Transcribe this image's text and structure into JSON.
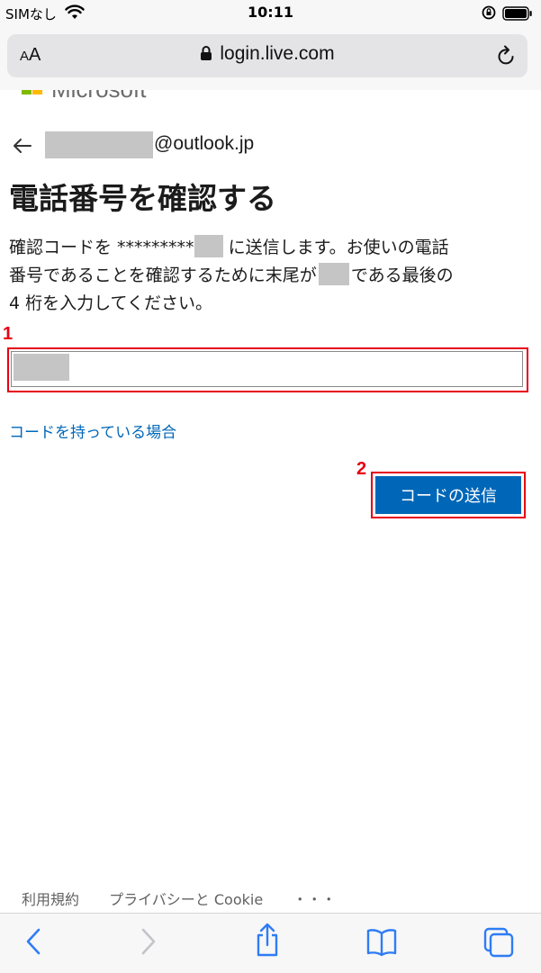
{
  "status_bar": {
    "carrier": "SIMなし",
    "time": "10:11"
  },
  "address_bar": {
    "text_size_label_big": "A",
    "text_size_label_small": "A",
    "url": "login.live.com"
  },
  "page": {
    "brand": "Microsoft",
    "account_email": "@outlook.jp",
    "title": "電話番号を確認する",
    "description_lines": [
      "確認コードを *********",
      " に送信します。お使いの電話",
      "番号であることを確認するために末尾が",
      "である最後の",
      "4 桁を入力してください。"
    ],
    "have_code_link": "コードを持っている場合",
    "send_button": "コードの送信"
  },
  "annotations": {
    "step1": "1",
    "step2": "2"
  },
  "footer": {
    "terms": "利用規約",
    "privacy": "プライバシーと Cookie",
    "more": "・・・"
  },
  "colors": {
    "accent_blue": "#0067b8",
    "annotation_red": "#e60012",
    "mask_gray": "#c5c5c5"
  }
}
